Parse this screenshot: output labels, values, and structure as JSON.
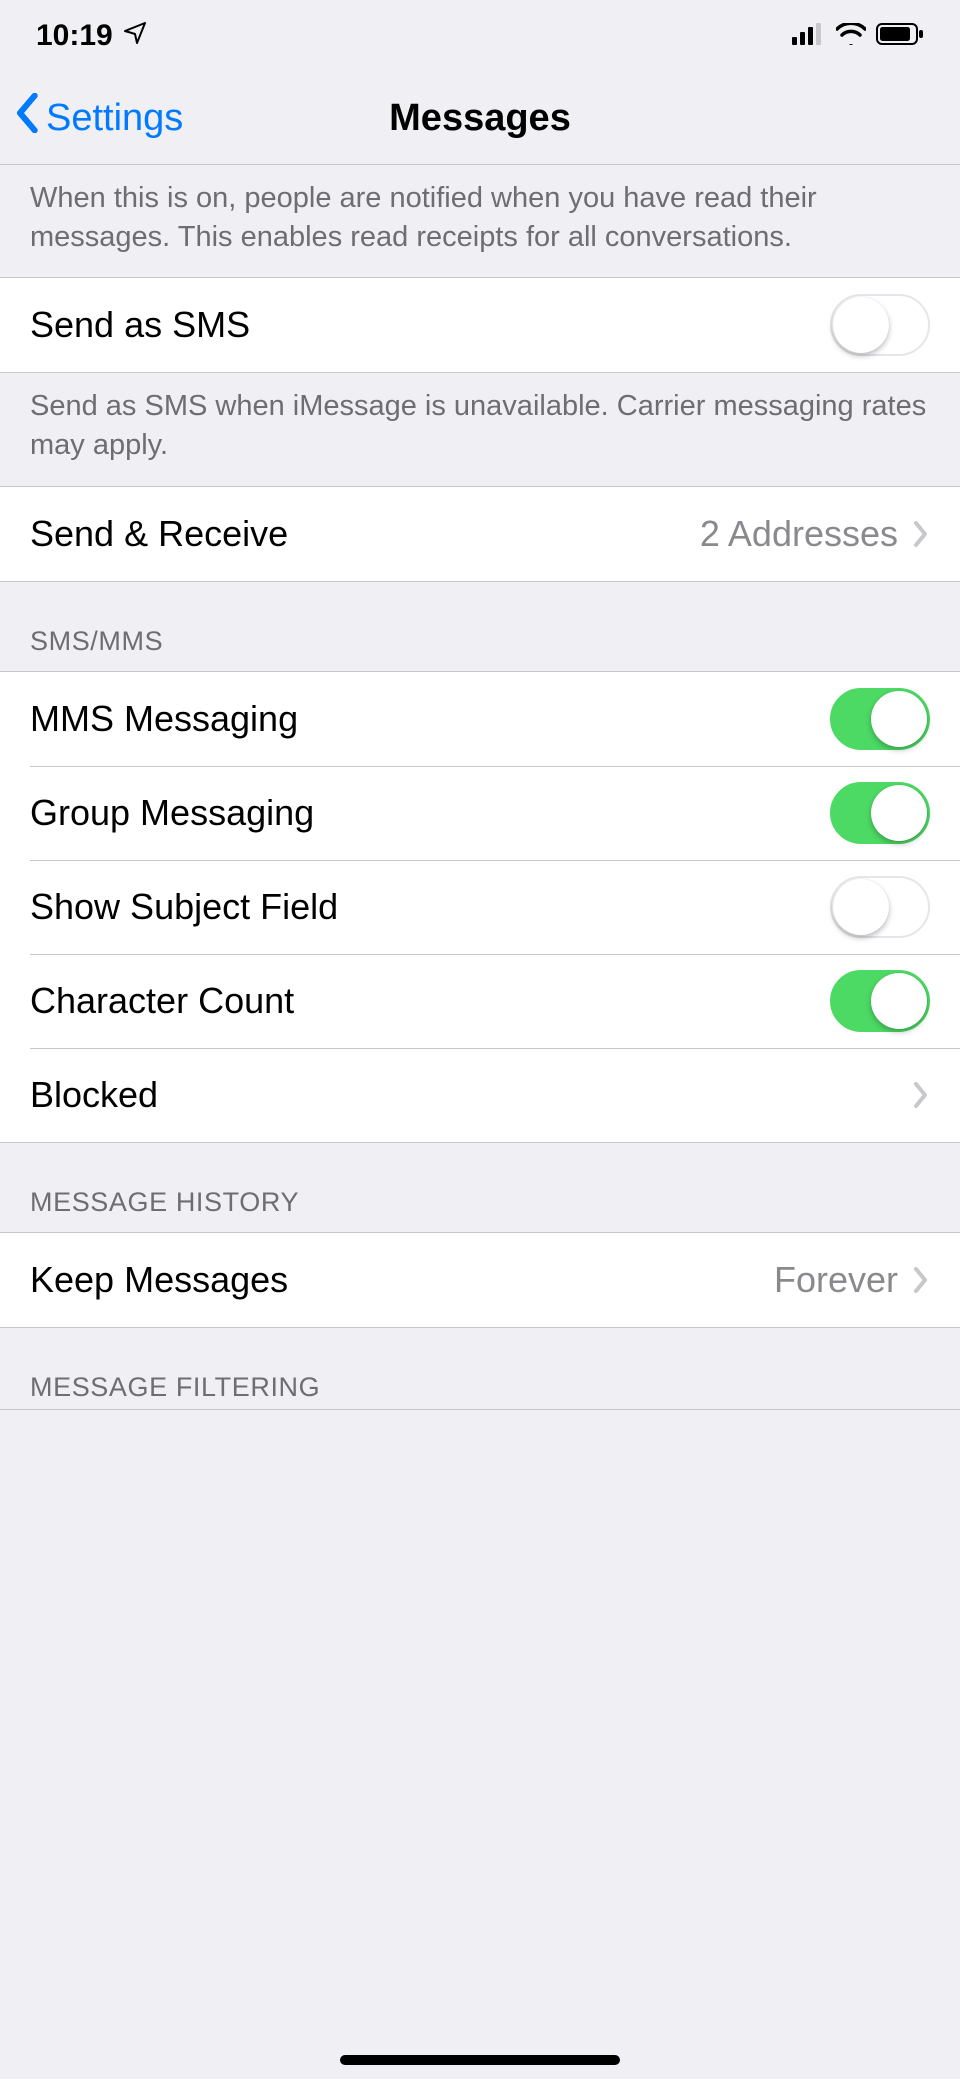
{
  "status": {
    "time": "10:19"
  },
  "nav": {
    "back": "Settings",
    "title": "Messages"
  },
  "readReceipts": {
    "footer": "When this is on, people are notified when you have read their messages. This enables read receipts for all conversations."
  },
  "sendSms": {
    "label": "Send as SMS",
    "footer": "Send as SMS when iMessage is unavailable. Carrier messaging rates may apply."
  },
  "sendReceive": {
    "label": "Send & Receive",
    "detail": "2 Addresses"
  },
  "smsMms": {
    "header": "SMS/MMS",
    "mms": "MMS Messaging",
    "group": "Group Messaging",
    "subject": "Show Subject Field",
    "charCount": "Character Count",
    "blocked": "Blocked"
  },
  "history": {
    "header": "MESSAGE HISTORY",
    "keep": "Keep Messages",
    "keepDetail": "Forever"
  },
  "filtering": {
    "header": "MESSAGE FILTERING"
  }
}
